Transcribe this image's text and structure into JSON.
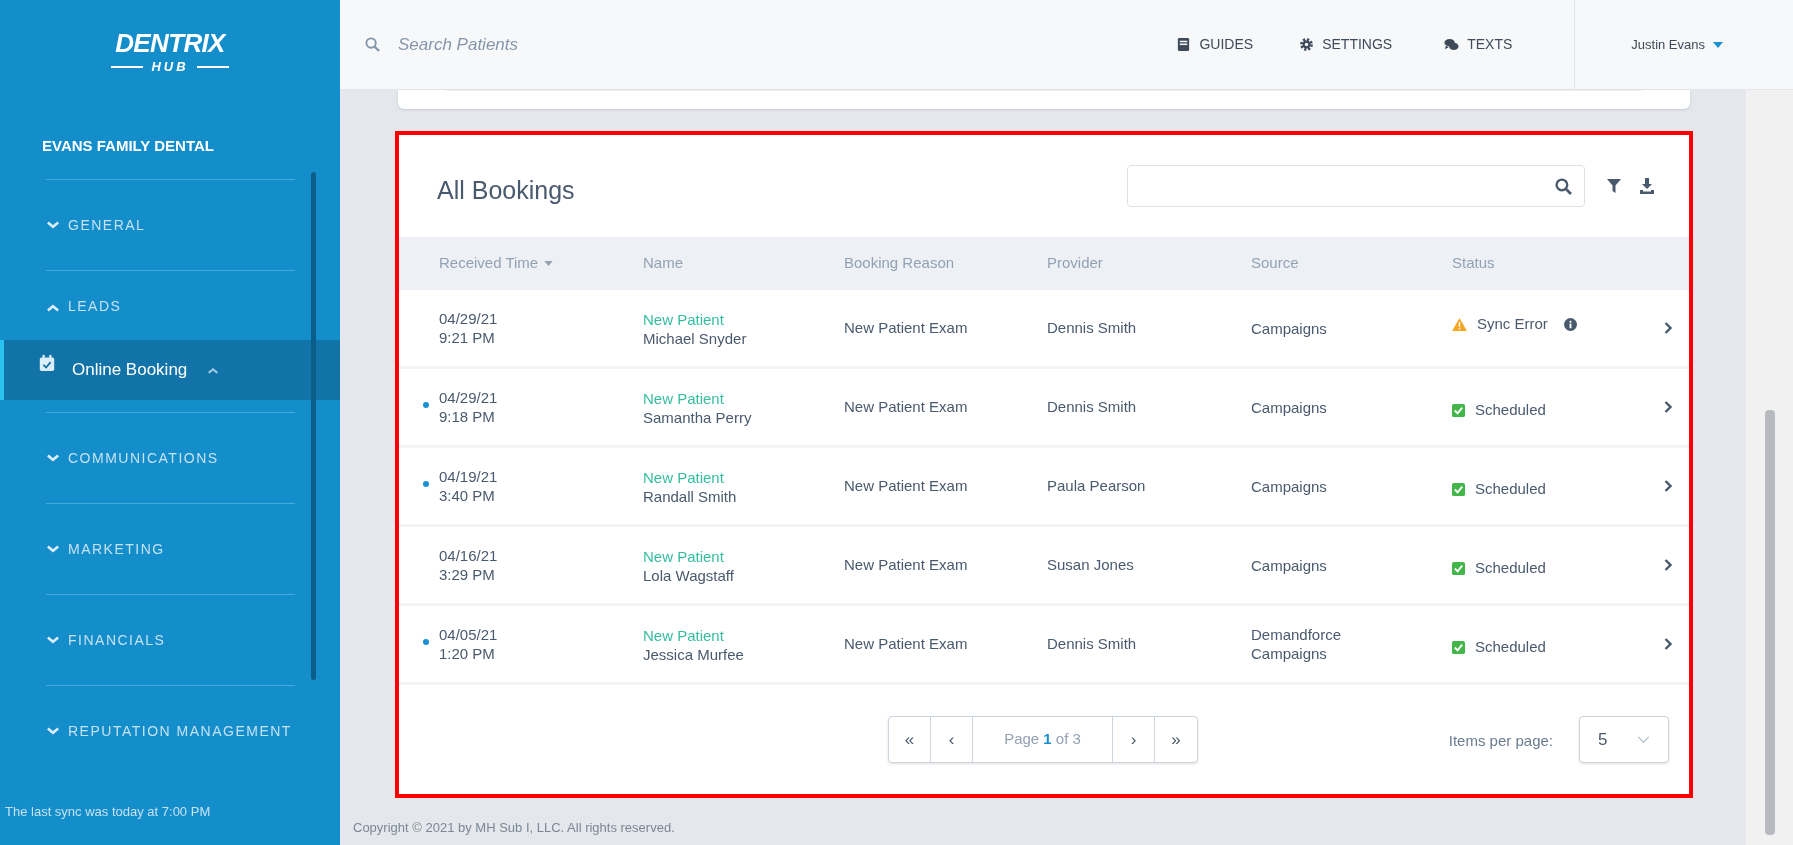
{
  "sidebar": {
    "logo": {
      "title": "DENTRIX",
      "subtitle": "HUB"
    },
    "practice": "EVANS FAMILY DENTAL",
    "sections": [
      {
        "label": "GENERAL",
        "expanded": false
      },
      {
        "label": "LEADS",
        "expanded": true,
        "children": [
          {
            "label": "Online Booking",
            "selected": true
          }
        ]
      },
      {
        "label": "COMMUNICATIONS",
        "expanded": false
      },
      {
        "label": "MARKETING",
        "expanded": false
      },
      {
        "label": "FINANCIALS",
        "expanded": false
      },
      {
        "label": "REPUTATION MANAGEMENT",
        "expanded": false
      }
    ],
    "sync_note": "The last sync was today at 7:00 PM"
  },
  "header": {
    "search": {
      "placeholder": "Search Patients"
    },
    "links": [
      {
        "kind": "guides",
        "label": "GUIDES"
      },
      {
        "kind": "settings",
        "label": "SETTINGS"
      },
      {
        "kind": "texts",
        "label": "TEXTS"
      }
    ],
    "user": "Justin Evans"
  },
  "bookings": {
    "title": "All Bookings",
    "columns": [
      "Received Time",
      "Name",
      "Booking Reason",
      "Provider",
      "Source",
      "Status"
    ],
    "rows": [
      {
        "unread": false,
        "date": "04/29/21",
        "time": "9:21 PM",
        "patient_type": "New Patient",
        "name": "Michael Snyder",
        "reason": "New Patient Exam",
        "provider": "Dennis Smith",
        "source": "Campaigns",
        "status": {
          "kind": "error",
          "label": "Sync Error"
        }
      },
      {
        "unread": true,
        "date": "04/29/21",
        "time": "9:18 PM",
        "patient_type": "New Patient",
        "name": "Samantha Perry",
        "reason": "New Patient Exam",
        "provider": "Dennis Smith",
        "source": "Campaigns",
        "status": {
          "kind": "scheduled",
          "label": "Scheduled"
        }
      },
      {
        "unread": true,
        "date": "04/19/21",
        "time": "3:40 PM",
        "patient_type": "New Patient",
        "name": "Randall Smith",
        "reason": "New Patient Exam",
        "provider": "Paula Pearson",
        "source": "Campaigns",
        "status": {
          "kind": "scheduled",
          "label": "Scheduled"
        }
      },
      {
        "unread": false,
        "date": "04/16/21",
        "time": "3:29 PM",
        "patient_type": "New Patient",
        "name": "Lola Wagstaff",
        "reason": "New Patient Exam",
        "provider": "Susan Jones",
        "source": "Campaigns",
        "status": {
          "kind": "scheduled",
          "label": "Scheduled"
        }
      },
      {
        "unread": true,
        "date": "04/05/21",
        "time": "1:20 PM",
        "patient_type": "New Patient",
        "name": "Jessica Murfee",
        "reason": "New Patient Exam",
        "provider": "Dennis Smith",
        "source": "Demandforce\nCampaigns",
        "status": {
          "kind": "scheduled",
          "label": "Scheduled"
        }
      }
    ],
    "pagination": {
      "first": "«",
      "prev": "‹",
      "page_label": "Page **1** of 3",
      "next": "›",
      "last": "»",
      "items_label": "Items per page:",
      "items_value": "5"
    }
  },
  "footer": "Copyright © 2021 by MH Sub I, LLC. All rights reserved."
}
